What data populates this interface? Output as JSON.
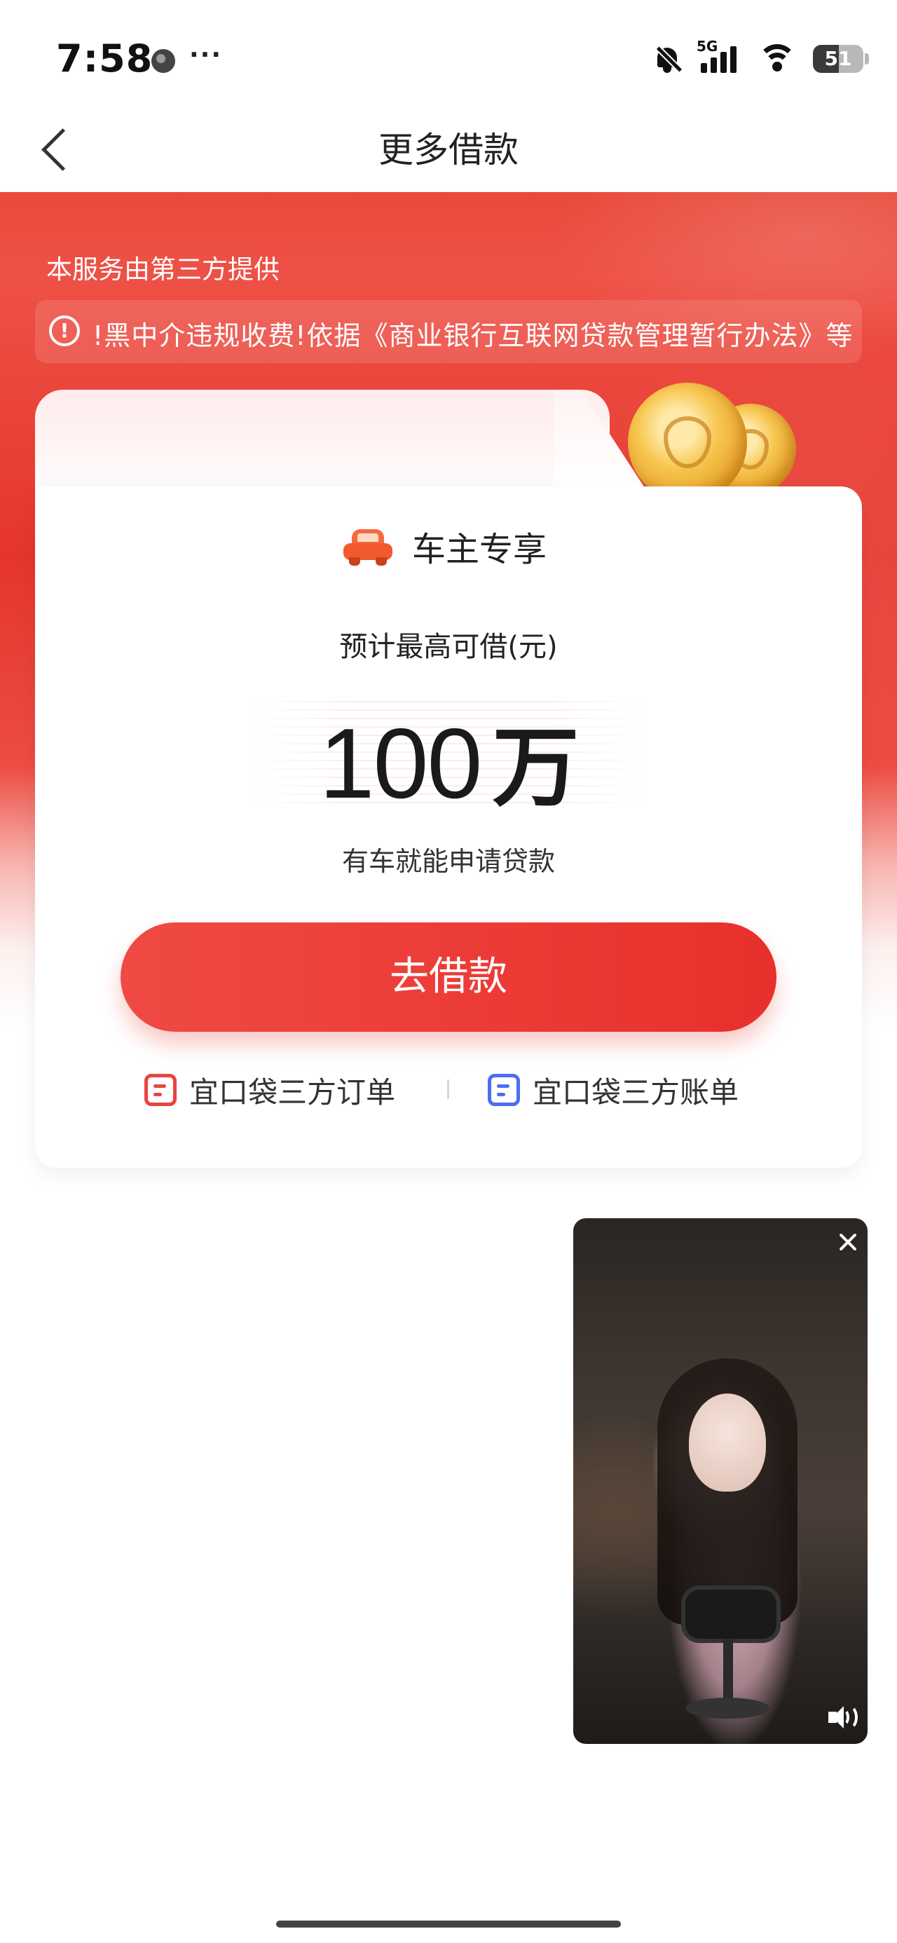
{
  "status_bar": {
    "time": "7:58",
    "more": "···",
    "network": "5G",
    "battery": "51",
    "battery_level": 0.51
  },
  "nav": {
    "title": "更多借款"
  },
  "hero": {
    "provider_text": "本服务由第三方提供",
    "notice_text": "!黑中介违规收费!依据《商业银行互联网贷款管理暂行办法》等"
  },
  "card": {
    "badge": "车主专享",
    "limit_label": "预计最高可借(元)",
    "amount": "100",
    "amount_unit": "万",
    "subtitle": "有车就能申请贷款",
    "borrow_button": "去借款",
    "link_orders": "宜口袋三方订单",
    "link_bills": "宜口袋三方账单"
  },
  "colors": {
    "brand_red": "#ec3a35",
    "orders_icon": "#e8453f",
    "bills_icon": "#4f6df0"
  }
}
